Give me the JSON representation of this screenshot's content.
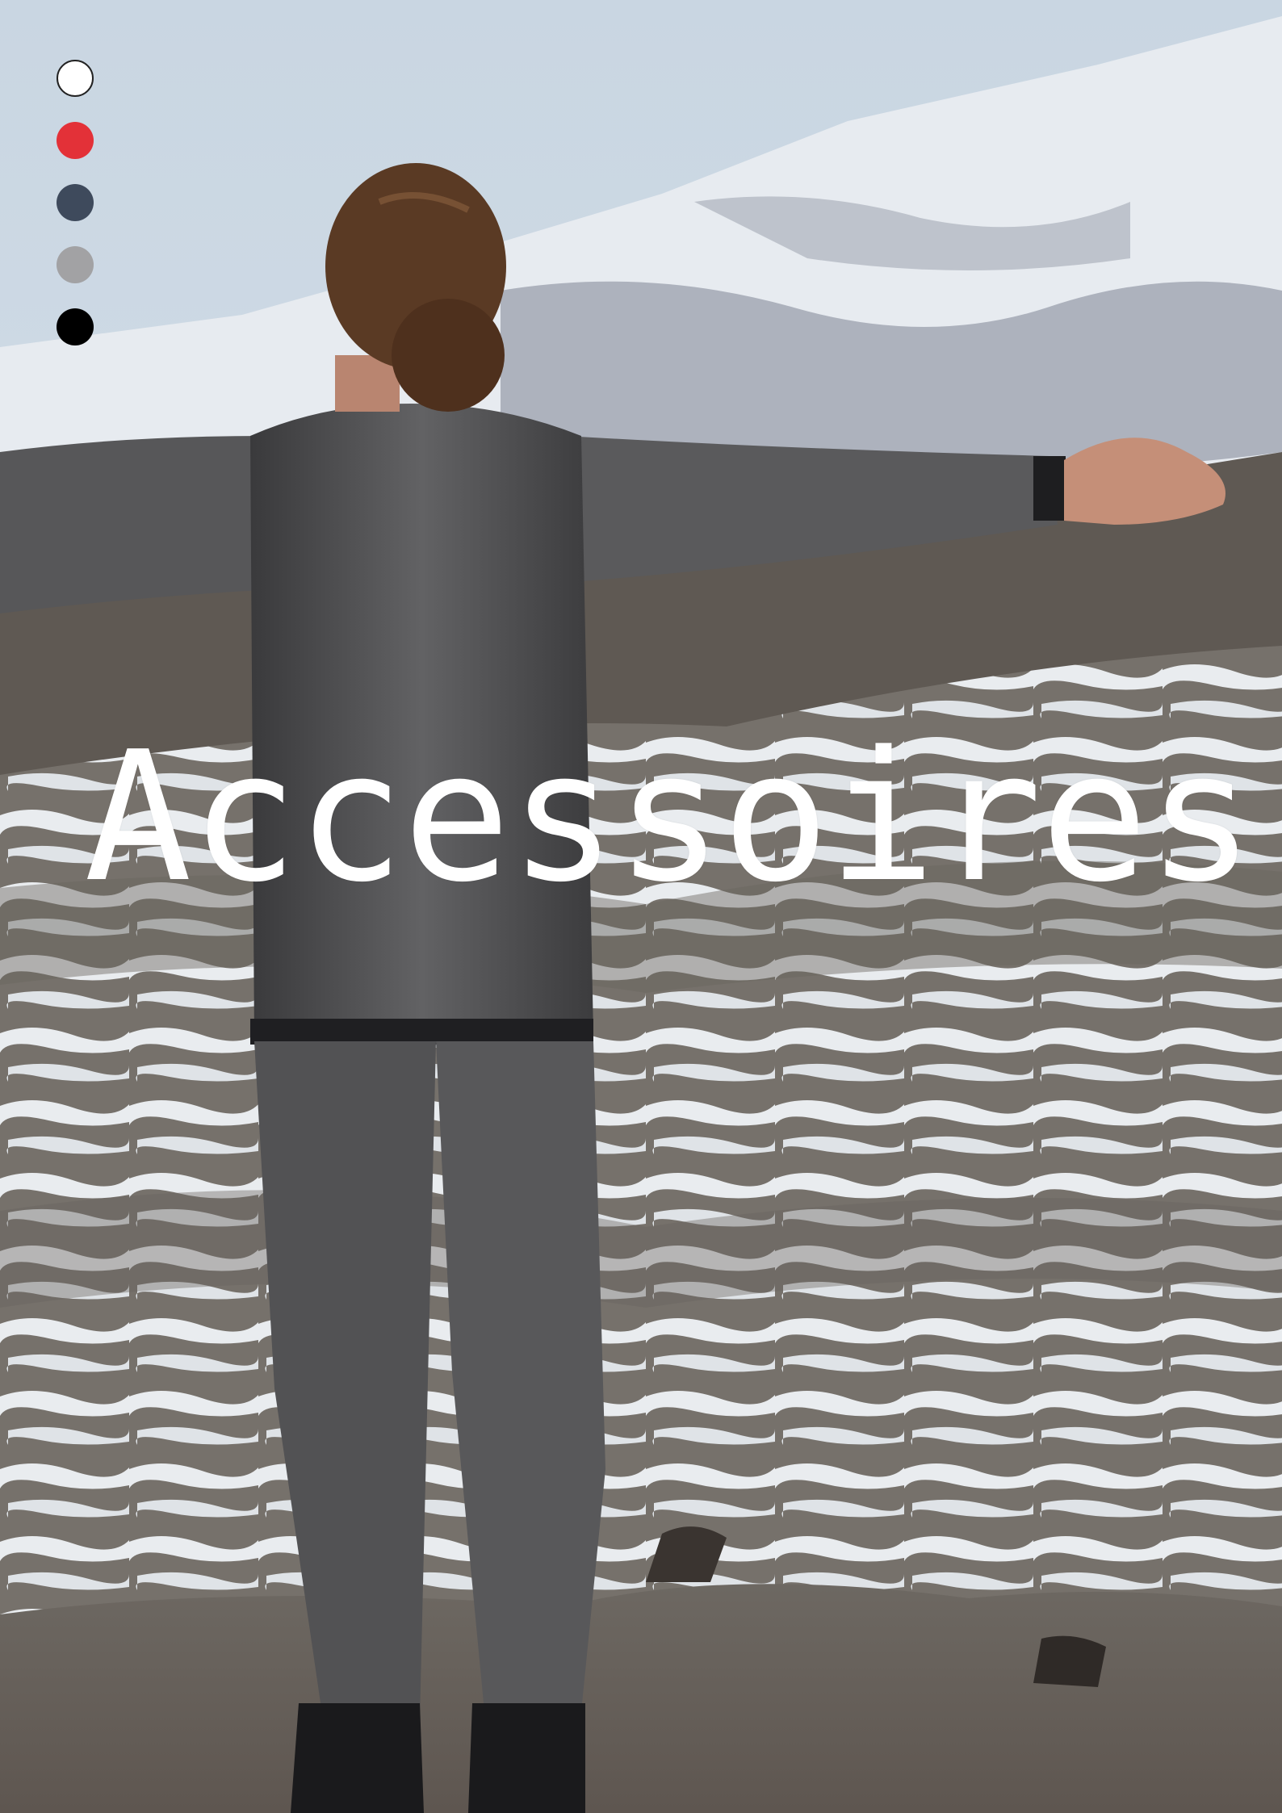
{
  "title": "Accessoires",
  "swatches": [
    {
      "color": "#ffffff",
      "name": "white"
    },
    {
      "color": "#e33138",
      "name": "red"
    },
    {
      "color": "#3e4a5c",
      "name": "navy"
    },
    {
      "color": "#a2a2a4",
      "name": "grey"
    },
    {
      "color": "#000000",
      "name": "black"
    }
  ]
}
